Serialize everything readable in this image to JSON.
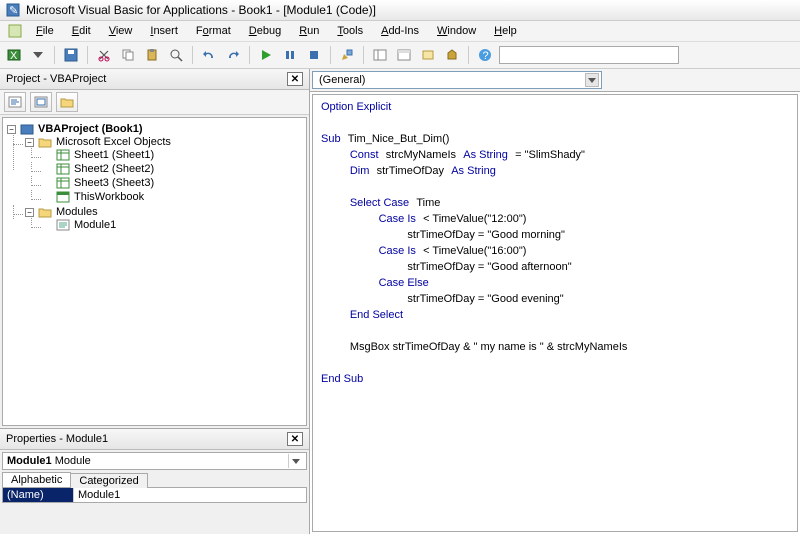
{
  "title": "Microsoft Visual Basic for Applications - Book1 - [Module1 (Code)]",
  "menu": [
    "File",
    "Edit",
    "View",
    "Insert",
    "Format",
    "Debug",
    "Run",
    "Tools",
    "Add-Ins",
    "Window",
    "Help"
  ],
  "project_panel_title": "Project - VBAProject",
  "tree": {
    "root": "VBAProject (Book1)",
    "excel_objects_label": "Microsoft Excel Objects",
    "sheets": [
      "Sheet1 (Sheet1)",
      "Sheet2 (Sheet2)",
      "Sheet3 (Sheet3)",
      "ThisWorkbook"
    ],
    "modules_label": "Modules",
    "module_name": "Module1"
  },
  "properties": {
    "title": "Properties - Module1",
    "object_name": "Module1",
    "object_type": "Module",
    "tabs": [
      "Alphabetic",
      "Categorized"
    ],
    "rows": [
      {
        "key": "(Name)",
        "value": "Module1"
      }
    ]
  },
  "object_combo": "(General)",
  "code": {
    "l1a": "Option Explicit",
    "l2a": "Sub",
    " l2b": "Tim_Nice_But_Dim()",
    "l3a": "Const",
    "l3b": "strcMyNameIs",
    "l3c": "As String",
    "l3d": "= \"SlimShady\"",
    "l4a": "Dim",
    "l4b": "strTimeOfDay",
    "l4c": "As String",
    "l5a": "Select Case",
    "l5b": "Time",
    "l6a": "Case Is",
    "l6b": "< TimeValue(\"12:00\")",
    "l7": "strTimeOfDay = \"Good morning\"",
    "l8a": "Case Is",
    "l8b": "< TimeValue(\"16:00\")",
    "l9": "strTimeOfDay = \"Good afternoon\"",
    "l10a": "Case Else",
    "l11": "strTimeOfDay = \"Good evening\"",
    "l12a": "End Select",
    "l13": "MsgBox strTimeOfDay & \" my name is \" & strcMyNameIs",
    "l14a": "End Sub"
  }
}
